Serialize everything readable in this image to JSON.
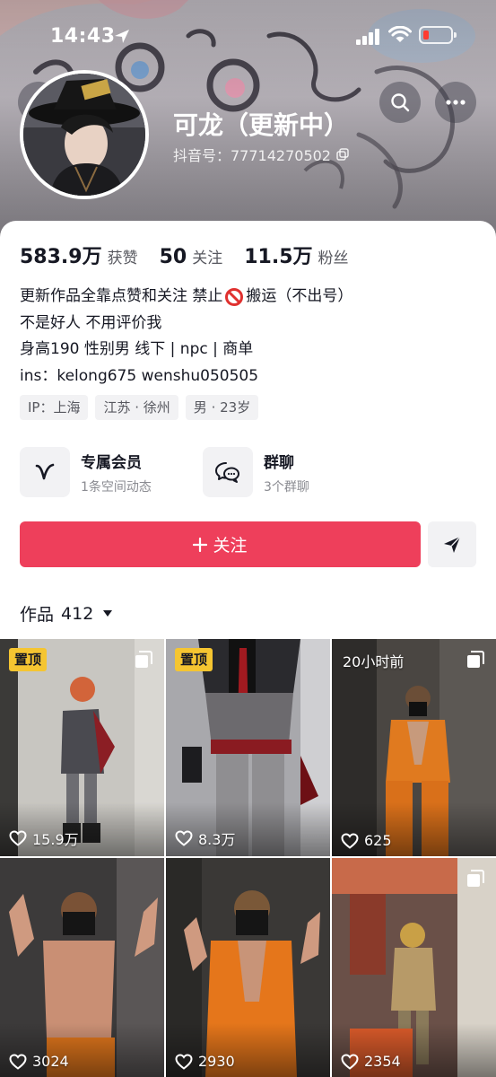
{
  "status_bar": {
    "time": "14:43"
  },
  "profile": {
    "nickname": "可龙（更新中）",
    "douyin_id": "抖音号：77714270502"
  },
  "stats": [
    {
      "value": "583.9万",
      "label": "获赞"
    },
    {
      "value": "50",
      "label": "关注"
    },
    {
      "value": "11.5万",
      "label": "粉丝"
    }
  ],
  "bio": {
    "line1_a": "更新作品全靠点赞和关注 禁止",
    "line1_b": "搬运（不出号）",
    "line2": "不是好人 不用评价我",
    "line3": "身高190 性别男 线下 | npc | 商单",
    "line4": "ins：kelong675 wenshu050505"
  },
  "tags": [
    "IP：上海",
    "江苏 · 徐州",
    "男 · 23岁"
  ],
  "entries": {
    "membership": {
      "title": "专属会员",
      "subtitle": "1条空间动态",
      "icon": "v-icon"
    },
    "group_chat": {
      "title": "群聊",
      "subtitle": "3个群聊",
      "icon": "chat-bubbles-icon"
    }
  },
  "actions": {
    "follow_label": "关注",
    "follow_icon": "plus-icon",
    "share_icon": "send-icon"
  },
  "works": {
    "label": "作品",
    "count": "412"
  },
  "videos": [
    {
      "badge": "置顶",
      "likes": "15.9万",
      "multi": true
    },
    {
      "badge": "置顶",
      "likes": "8.3万",
      "multi": false
    },
    {
      "badge": "20小时前",
      "likes": "625",
      "multi": true
    },
    {
      "badge": "",
      "likes": "3024",
      "multi": false
    },
    {
      "badge": "",
      "likes": "2930",
      "multi": false
    },
    {
      "badge": "",
      "likes": "2354",
      "multi": true
    }
  ],
  "colors": {
    "accent": "#ee3f5b",
    "pinned_badge": "#f5c531",
    "text_primary": "#161823",
    "text_secondary": "#57585f"
  }
}
